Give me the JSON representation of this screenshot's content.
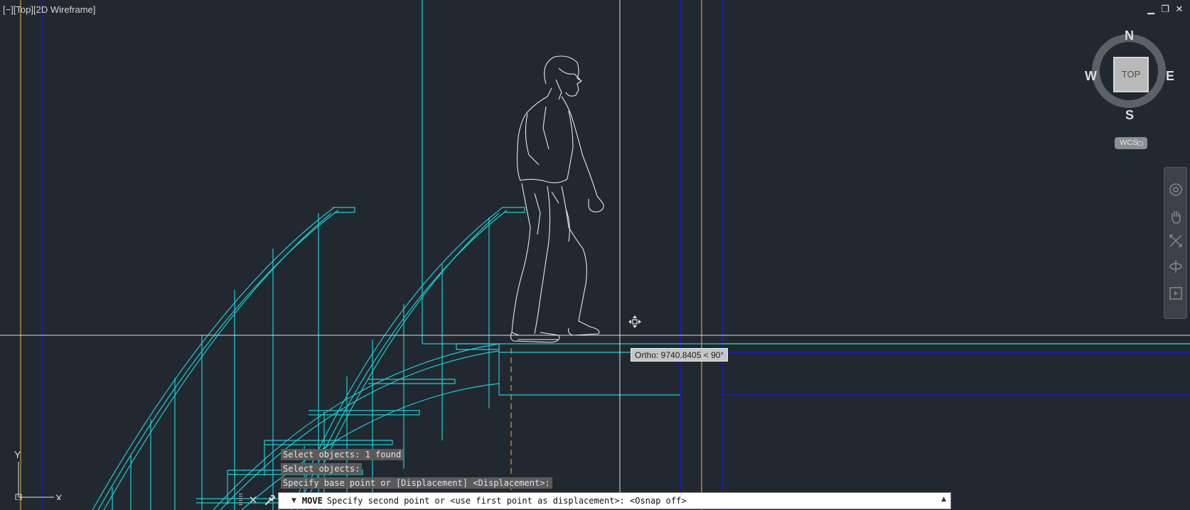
{
  "viewport": {
    "label": "[−][Top][2D Wireframe]"
  },
  "window_controls": {
    "minimize": "▁",
    "restore": "❐",
    "close": "✕"
  },
  "viewcube": {
    "face": "TOP",
    "north": "N",
    "south": "S",
    "east": "E",
    "west": "W",
    "wcs_label": "WCS"
  },
  "tooltip": {
    "ortho": "Ortho: 9740.8405 < 90°"
  },
  "command": {
    "history": [
      "Select objects: 1 found",
      "Select objects:",
      "Specify base point or [Displacement] <Displacement>:"
    ],
    "name": "MOVE",
    "prompt": "Specify second point or <use first point as displacement>:  <Osnap off>",
    "close_icon": "✕",
    "settings_icon": "🔧"
  },
  "ucs": {
    "x": "X",
    "y": "Y"
  },
  "colors": {
    "background": "#212830",
    "cyan": "#1ecdd4",
    "white_figure": "#e8e8e8",
    "blue_lines": "#1a1acf",
    "orange_lines": "#c8a040",
    "crosshair": "#e0e0e0"
  }
}
